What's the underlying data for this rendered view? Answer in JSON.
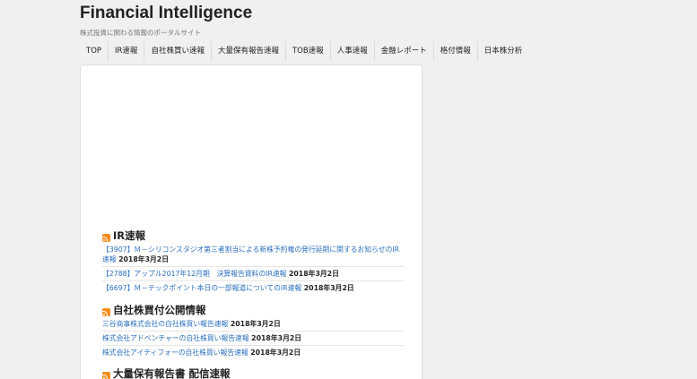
{
  "header": {
    "site_title": "Financial Intelligence",
    "tagline": "株式投資に関わる情報のポータルサイト"
  },
  "nav": [
    "TOP",
    "IR速報",
    "自社株買い速報",
    "大量保有報告速報",
    "TOB速報",
    "人事速報",
    "金融レポート",
    "格付情報",
    "日本株分析"
  ],
  "sections": [
    {
      "title": "IR速報",
      "items": [
        {
          "link": "【3907】Ｍ－シリコンスタジオ第三者割当による新株予約権の発行延期に関するお知らせのIR速報",
          "date": "2018年3月2日"
        },
        {
          "link": "【2788】アップル2017年12月期　決算報告資料のIR速報",
          "date": "2018年3月2日"
        },
        {
          "link": "【6697】Ｍ－テックポイント本日の一部報道についてのIR速報",
          "date": "2018年3月2日"
        }
      ]
    },
    {
      "title": "自社株買付公開情報",
      "items": [
        {
          "link": "三谷商事株式会社の自社株買い報告速報",
          "date": "2018年3月2日"
        },
        {
          "link": "株式会社アドベンチャーの自社株買い報告速報",
          "date": "2018年3月2日"
        },
        {
          "link": "株式会社アイティフォーの自社株買い報告速報",
          "date": "2018年3月2日"
        }
      ]
    },
    {
      "title": "大量保有報告書 配信速報",
      "items": []
    }
  ],
  "colors": {
    "link": "#2a6fbf",
    "rss": "#f48c1c",
    "background": "#f0f0f0"
  }
}
